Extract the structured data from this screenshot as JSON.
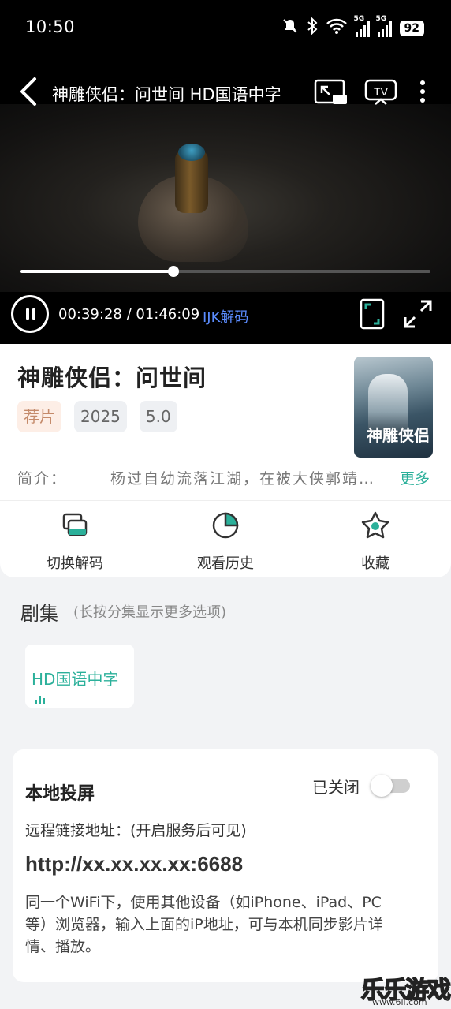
{
  "status_bar": {
    "time": "10:50",
    "battery": "92",
    "network_1": "5G",
    "network_2": "5G"
  },
  "player": {
    "title": "神雕侠侣：问世间 HD国语中字",
    "time_text": "00:39:28 / 01:46:09",
    "decoder": "IJK解码",
    "progress": 0.374
  },
  "movie": {
    "title": "神雕侠侣：问世间",
    "tags": [
      "荐片",
      "2025",
      "5.0"
    ],
    "intro_label": "简介：",
    "intro_text": "杨过自幼流落江湖，在被大侠郭靖收养后",
    "more_label": "更多"
  },
  "actions": [
    {
      "label": "切换解码",
      "icon": "switch-decoder-icon"
    },
    {
      "label": "观看历史",
      "icon": "history-pie-icon"
    },
    {
      "label": "收藏",
      "icon": "star-icon"
    }
  ],
  "episodes": {
    "title": "剧集",
    "hint": "(长按分集显示更多选项)",
    "items": [
      {
        "label": "HD国语中字"
      }
    ]
  },
  "cast": {
    "title": "本地投屏",
    "status": "已关闭",
    "toggle_on": false,
    "remote_label": "远程链接地址：(开启服务后可见)",
    "url": "http://xx.xx.xx.xx:6688",
    "description": "同一个WiFi下，使用其他设备（如iPhone、iPad、PC等）浏览器，输入上面的iP地址，可与本机同步影片详情、播放。"
  },
  "watermark": {
    "text": "乐乐游戏",
    "url": "www.6ll.com"
  },
  "colors": {
    "accent": "#2bb09a",
    "decoder": "#5b8cff",
    "player_bg": "#000000"
  }
}
